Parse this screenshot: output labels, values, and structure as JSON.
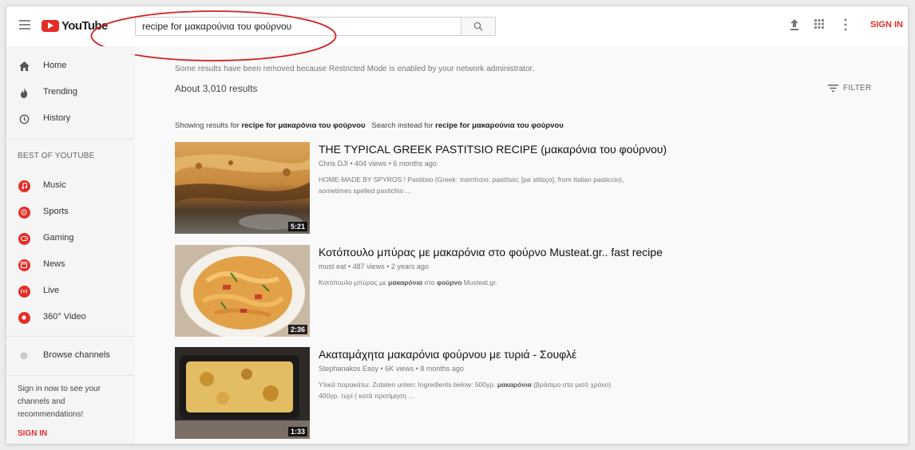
{
  "header": {
    "logo_text": "YouTube",
    "search_value": "recipe for μακαρούνια του φούρνου",
    "signin_label": "SIGN IN",
    "icons": [
      "menu-icon",
      "upload-icon",
      "apps-grid-icon",
      "more-vert-icon",
      "search-icon"
    ]
  },
  "sidebar": {
    "home": "Home",
    "trending": "Trending",
    "history": "History",
    "best_heading": "BEST OF YOUTUBE",
    "music": "Music",
    "sports": "Sports",
    "gaming": "Gaming",
    "news": "News",
    "live": "Live",
    "video360": "360° Video",
    "browse": "Browse channels",
    "signin_message": "Sign in now to see your channels and recommendations!",
    "signin_label": "SIGN IN"
  },
  "main": {
    "restricted_note": "Some results have been removed because Restricted Mode is enabled by your network administrator.",
    "results_count": "About 3,010 results",
    "filter_label": "FILTER",
    "showing_prefix": "Showing results for",
    "showing_query": "recipe for μακαρόνια του φούρνου",
    "instead_prefix": "Search instead for",
    "instead_query": "recipe for μακαρούνια του φούρνου"
  },
  "results": [
    {
      "title": "THE TYPICAL GREEK PASTITSIO RECIPE (μακαρόνια του φούρνου)",
      "meta": "Chris DJI • 404 views • 6 months ago",
      "desc_line1": "HOME-MADE BY SPYROS ! Pastitsio (Greek: παστίτσιο, pastítsio; [pa΄stitsço], from Italian pasticcio),",
      "desc_line2": "sometimes spelled pastichio ...",
      "duration": "5:21"
    },
    {
      "title": "Κοτόπουλο μπύρας με μακαρόνια στο φούρνο Musteat.gr.. fast recipe",
      "meta": "must eat • 487 views • 2 years ago",
      "desc_a": "Κοτόπουλο μπύρας με",
      "desc_b": "μακαρόνια",
      "desc_c": "στο",
      "desc_d": "φούρνο",
      "desc_e": "Musteat.gr.",
      "duration": "2:36"
    },
    {
      "title": "Ακαταμάχητα μακαρόνια φούρνου με τυριά - Σουφλέ",
      "meta": "Stephanakos Easy • 6K views • 8 months ago",
      "desc_a": "Υλικά παρακάτω: Zutaten unten: Ingredients below: 500γρ.",
      "desc_b": "μακαρόνια",
      "desc_c": "(βράσιμο στο μισό χρόνο)",
      "desc_line2": "400γρ. τυρί ( κατά προτίμηση ...",
      "duration": "1:33"
    }
  ],
  "colors": {
    "accent_red": "#e52d27",
    "annotation_ellipse": "#d61f1f",
    "sidebar_bg": "#f5f5f5",
    "page_bg": "#f9f9f9"
  }
}
